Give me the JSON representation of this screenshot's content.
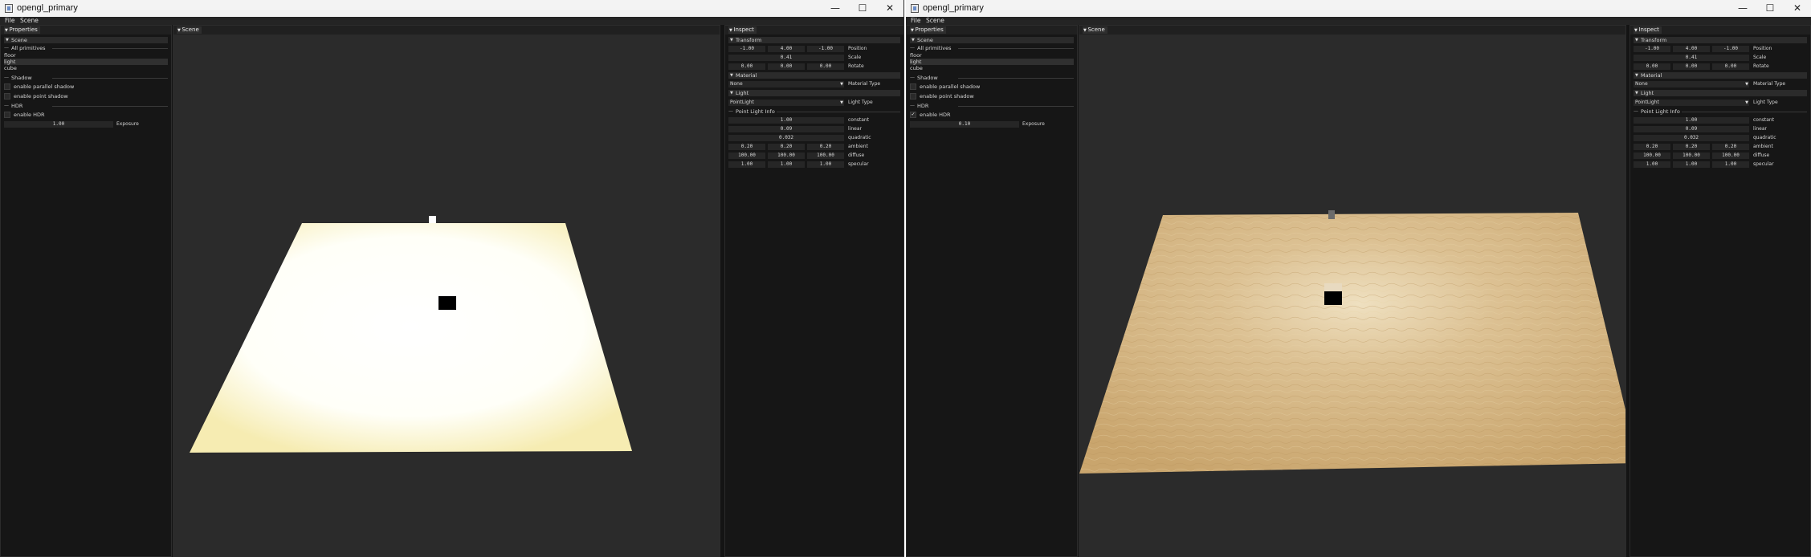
{
  "windows": [
    {
      "title": "opengl_primary",
      "menu": [
        "File",
        "Scene"
      ],
      "properties": {
        "title": "Properties",
        "scene_header": "Scene",
        "all_primitives": "All primitives",
        "primitives": [
          "floor",
          "light",
          "cube"
        ],
        "shadow_header": "Shadow",
        "parallel_shadow": "enable parallel shadow",
        "point_shadow": "enable point shadow",
        "hdr_header": "HDR",
        "enable_hdr": "enable HDR",
        "hdr_checked": false,
        "exposure_value": "1.00",
        "exposure_label": "Exposure"
      },
      "scene_title": "Scene",
      "floor_appearance": "overexposed",
      "inspect": {
        "title": "Inspect",
        "transform_header": "Transform",
        "position": [
          "-1.00",
          "4.00",
          "-1.00"
        ],
        "position_label": "Position",
        "scale": "0.41",
        "scale_label": "Scale",
        "rotate": [
          "0.00",
          "0.00",
          "0.00"
        ],
        "rotate_label": "Rotate",
        "material_header": "Material",
        "material_type": "None",
        "material_type_label": "Material Type",
        "light_header": "Light",
        "light_type": "PointLight",
        "light_type_label": "Light Type",
        "point_light_info": "Point Light Info",
        "constant": "1.00",
        "constant_label": "constant",
        "linear": "0.09",
        "linear_label": "linear",
        "quadratic": "0.032",
        "quadratic_label": "quadratic",
        "ambient": [
          "0.20",
          "0.20",
          "0.20"
        ],
        "ambient_label": "ambient",
        "diffuse": [
          "100.00",
          "100.00",
          "100.00"
        ],
        "diffuse_label": "diffuse",
        "specular": [
          "1.00",
          "1.00",
          "1.00"
        ],
        "specular_label": "specular"
      }
    },
    {
      "title": "opengl_primary",
      "menu": [
        "File",
        "Scene"
      ],
      "properties": {
        "title": "Properties",
        "scene_header": "Scene",
        "all_primitives": "All primitives",
        "primitives": [
          "floor",
          "light",
          "cube"
        ],
        "shadow_header": "Shadow",
        "parallel_shadow": "enable parallel shadow",
        "point_shadow": "enable point shadow",
        "hdr_header": "HDR",
        "enable_hdr": "enable HDR",
        "hdr_checked": true,
        "exposure_value": "0.10",
        "exposure_label": "Exposure"
      },
      "scene_title": "Scene",
      "floor_appearance": "tonemapped",
      "inspect": {
        "title": "Inspect",
        "transform_header": "Transform",
        "position": [
          "-1.00",
          "4.00",
          "-1.00"
        ],
        "position_label": "Position",
        "scale": "0.41",
        "scale_label": "Scale",
        "rotate": [
          "0.00",
          "0.00",
          "0.00"
        ],
        "rotate_label": "Rotate",
        "material_header": "Material",
        "material_type": "None",
        "material_type_label": "Material Type",
        "light_header": "Light",
        "light_type": "PointLight",
        "light_type_label": "Light Type",
        "point_light_info": "Point Light Info",
        "constant": "1.00",
        "constant_label": "constant",
        "linear": "0.09",
        "linear_label": "linear",
        "quadratic": "0.032",
        "quadratic_label": "quadratic",
        "ambient": [
          "0.20",
          "0.20",
          "0.20"
        ],
        "ambient_label": "ambient",
        "diffuse": [
          "100.00",
          "100.00",
          "100.00"
        ],
        "diffuse_label": "diffuse",
        "specular": [
          "1.00",
          "1.00",
          "1.00"
        ],
        "specular_label": "specular"
      }
    }
  ],
  "colors": {
    "viewport_bg": "#2b2b2b",
    "panel_bg": "#161616",
    "floor_overexposed": "#fffef2",
    "floor_tonemapped": "#d8b98a"
  }
}
